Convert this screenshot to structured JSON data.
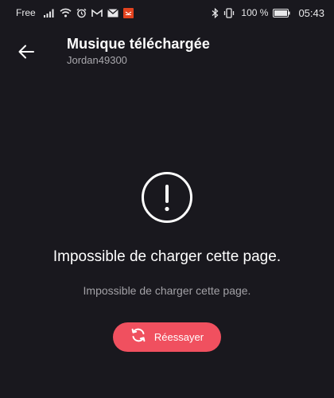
{
  "status_bar": {
    "carrier": "Free",
    "battery": "100 %",
    "time": "05:43",
    "icons": [
      "signal-icon",
      "wifi-icon",
      "alarm-icon",
      "gmail-icon",
      "mail-icon",
      "app-notification-icon",
      "bluetooth-icon",
      "vibrate-icon",
      "battery-icon"
    ]
  },
  "header": {
    "back_icon": "arrow-left-icon",
    "title": "Musique téléchargée",
    "subtitle": "Jordan49300"
  },
  "error": {
    "icon": "exclamation-circle-icon",
    "title": "Impossible de charger cette page.",
    "message": "Impossible de charger cette page.",
    "retry_label": "Réessayer",
    "retry_icon": "refresh-icon"
  },
  "colors": {
    "background": "#19181e",
    "accent": "#f0505f",
    "secondary_text": "#a2a1a6",
    "notification_badge": "#e3431f"
  }
}
